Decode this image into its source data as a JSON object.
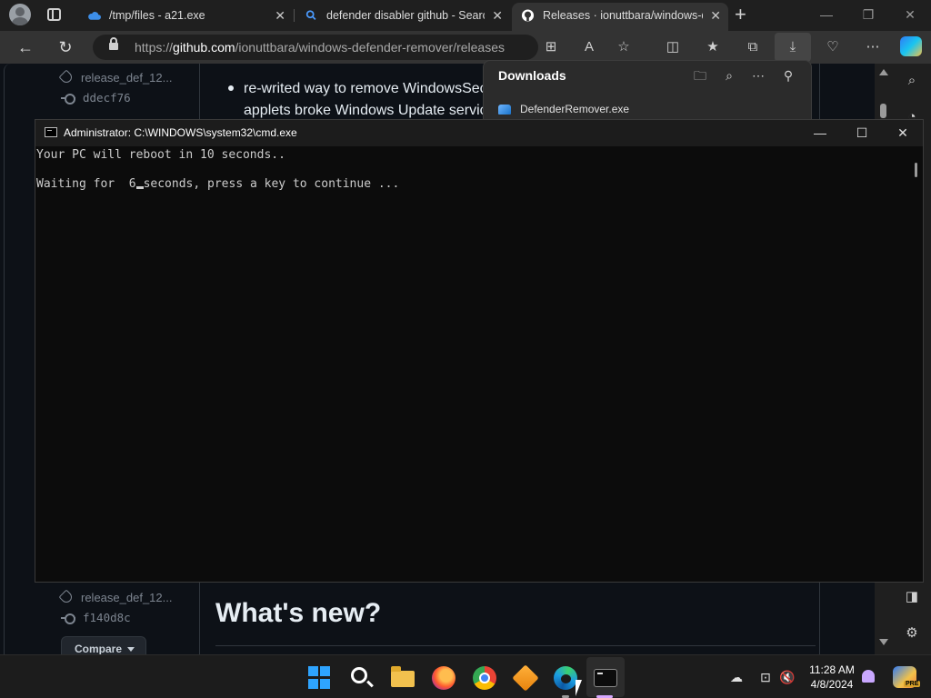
{
  "browser": {
    "tabs": [
      {
        "label": "/tmp/files - a21.exe",
        "close": "✕"
      },
      {
        "label": "defender disabler github - Search",
        "close": "✕"
      },
      {
        "label": "Releases · ionuttbara/windows-defender-remover",
        "close": "✕"
      }
    ],
    "new_tab": "+",
    "url_prefix": "https://",
    "url_host": "github.com",
    "url_path": "/ionuttbara/windows-defender-remover/releases",
    "window_controls": {
      "minimize": "—",
      "restore": "❐",
      "close": "✕"
    }
  },
  "page": {
    "release_tag_1": "release_def_12...",
    "commit_1": "ddecf76",
    "note_line_1": "re-writed way to remove WindowsSecurity",
    "note_line_2": "applets broke Windows Update services",
    "release_tag_2": "release_def_12...",
    "commit_2": "f140d8c",
    "compare_label": "Compare",
    "whats_new": "What's new?"
  },
  "downloads": {
    "title": "Downloads",
    "file_name": "DefenderRemover.exe"
  },
  "cmd": {
    "title": "Administrator: C:\\WINDOWS\\system32\\cmd.exe",
    "line_1": "Your PC will reboot in 10 seconds..",
    "line_2_before": "Waiting for  6",
    "line_2_after": "seconds, press a key to continue ...",
    "controls": {
      "minimize": "—",
      "maximize": "☐",
      "close": "✕"
    }
  },
  "taskbar": {
    "time": "11:28 AM",
    "date": "4/8/2024",
    "pre_badge": "PRE"
  },
  "colors": {
    "accent": "#2ea4ff",
    "cmd_background": "#0c0c0c",
    "page_background": "#0d1117"
  }
}
